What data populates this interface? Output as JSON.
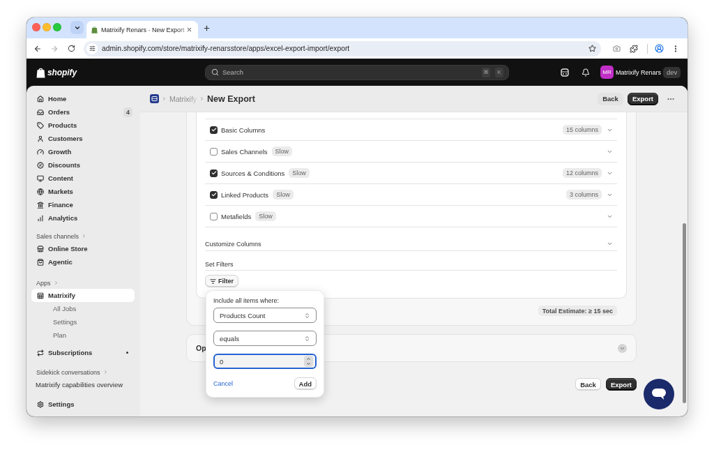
{
  "browser": {
    "tab_title": "Matrixify Renars · New Export",
    "url": "admin.shopify.com/store/matrixify-renarsstore/apps/excel-export-import/export"
  },
  "topbar": {
    "logo": "shopify",
    "search": {
      "placeholder": "Search",
      "keys": [
        "⌘",
        "K"
      ]
    },
    "account": {
      "initials": "MR",
      "name": "Matrixify Renars",
      "badge": "dev"
    }
  },
  "sidebar": {
    "groups": [
      {
        "kind": "nav",
        "items": [
          {
            "label": "Home",
            "selected": false
          },
          {
            "label": "Orders",
            "selected": false,
            "badge": "4"
          },
          {
            "label": "Products",
            "selected": false
          },
          {
            "label": "Customers",
            "selected": false
          },
          {
            "label": "Growth",
            "selected": false
          },
          {
            "label": "Discounts",
            "selected": false
          },
          {
            "label": "Content",
            "selected": false
          },
          {
            "label": "Markets",
            "selected": false
          },
          {
            "label": "Finance",
            "selected": false
          },
          {
            "label": "Analytics",
            "selected": false
          }
        ]
      },
      {
        "kind": "nav",
        "heading": "Sales channels",
        "items": [
          {
            "label": "Online Store",
            "selected": false
          },
          {
            "label": "Agentic",
            "selected": false
          }
        ]
      },
      {
        "kind": "nav",
        "heading": "Apps",
        "items": [
          {
            "label": "Matrixify",
            "selected": true,
            "dot": false,
            "children": [
              {
                "label": "All Jobs",
                "selected": false
              },
              {
                "label": "Settings",
                "selected": false
              },
              {
                "label": "Plan",
                "selected": false
              }
            ]
          },
          {
            "label": "Subscriptions",
            "selected": false,
            "dot": true
          }
        ]
      },
      {
        "kind": "conversations",
        "heading": "Sidekick conversations",
        "items": [
          {
            "label": "Matrixify capabilities overview",
            "selected": false
          }
        ]
      }
    ],
    "footer": {
      "label": "Settings",
      "selected": false
    }
  },
  "page": {
    "breadcrumb": "Matrixify",
    "title": "New Export",
    "actions": [
      {
        "label": "Back",
        "kind": "secondary"
      },
      {
        "label": "Export",
        "kind": "primary"
      }
    ]
  },
  "columns": [
    {
      "label": "Basic Columns",
      "checked": true,
      "count": "15 columns"
    },
    {
      "label": "Sales Channels",
      "checked": false,
      "tag": "Slow"
    },
    {
      "label": "Sources & Conditions",
      "checked": true,
      "tag": "Slow",
      "count": "12 columns"
    },
    {
      "label": "Linked Products",
      "checked": true,
      "tag": "Slow",
      "count": "3 columns"
    },
    {
      "label": "Metafields",
      "checked": false,
      "tag": "Slow"
    }
  ],
  "customize": {
    "label": "Customize Columns"
  },
  "filters": {
    "heading": "Set Filters",
    "button": "Filter"
  },
  "estimate": "Total Estimate: ≥ 15 sec",
  "options_card": {
    "title": "Op"
  },
  "footer_actions": [
    {
      "label": "Back",
      "kind": "secondary"
    },
    {
      "label": "Export",
      "kind": "primary"
    }
  ],
  "filter_popover": {
    "prompt": "Include all items where:",
    "field": {
      "value": "Products Count"
    },
    "operator": {
      "value": "equals"
    },
    "value_input": {
      "value": "0",
      "focused": true
    },
    "cancel": "Cancel",
    "add": "Add"
  }
}
